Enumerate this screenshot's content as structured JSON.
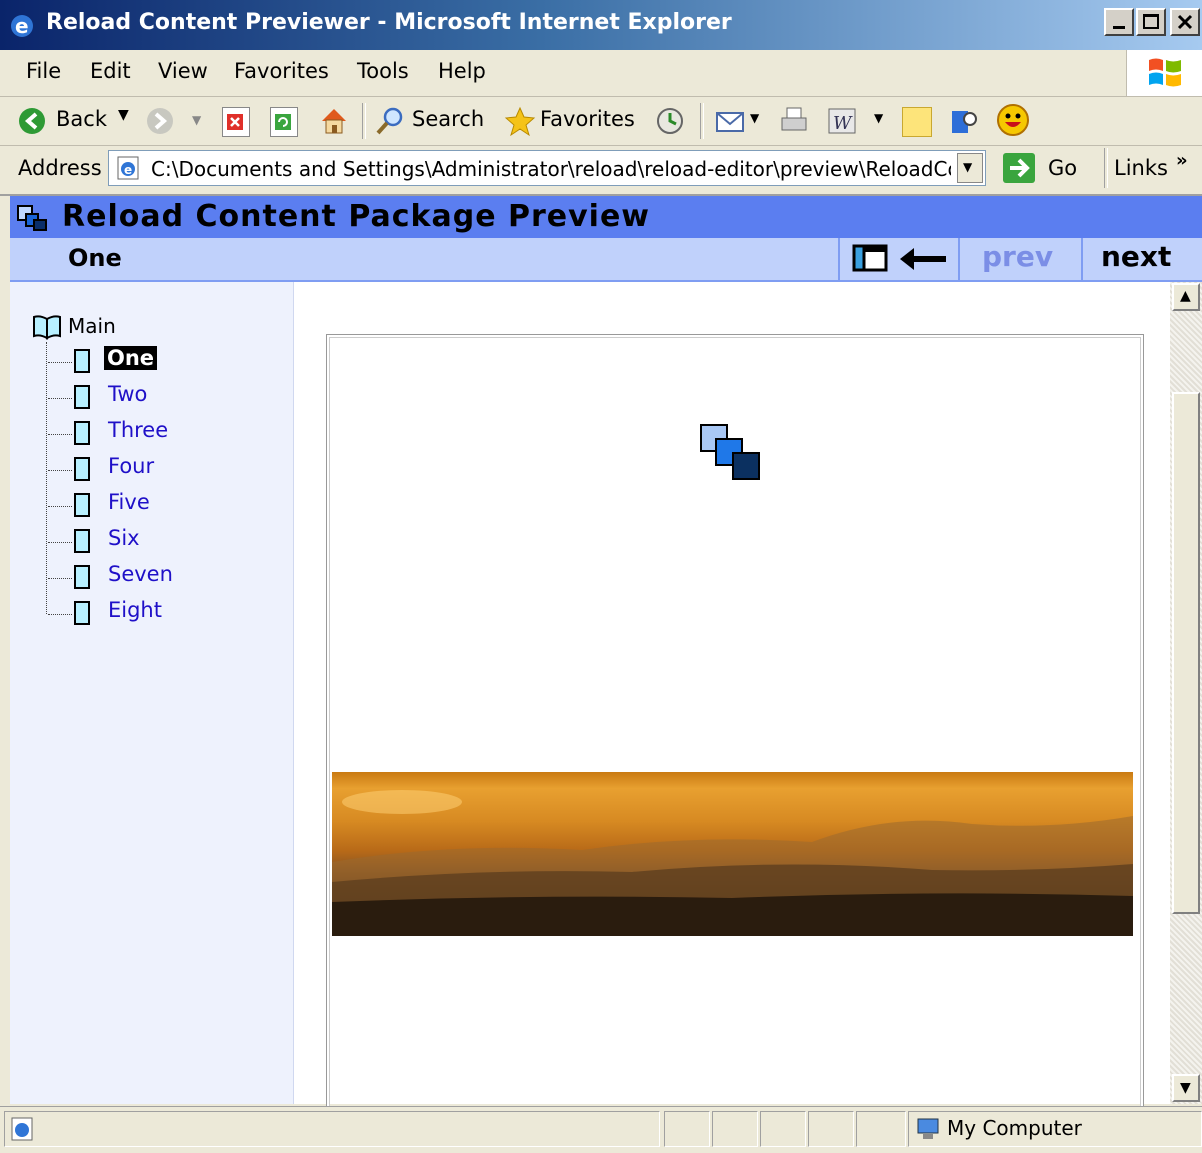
{
  "window": {
    "title": "Reload Content Previewer - Microsoft Internet Explorer"
  },
  "menu": [
    "File",
    "Edit",
    "View",
    "Favorites",
    "Tools",
    "Help"
  ],
  "toolbar": {
    "back_label": "Back",
    "search_label": "Search",
    "favorites_label": "Favorites"
  },
  "address": {
    "label": "Address",
    "value": "C:\\Documents and Settings\\Administrator\\reload\\reload-editor\\preview\\ReloadCont",
    "go_label": "Go",
    "links_label": "Links",
    "more_label": "»"
  },
  "preview": {
    "package_title": "Reload Content Package Preview",
    "current_item": "One",
    "prev_label": "prev",
    "next_label": "next"
  },
  "tree": {
    "root": "Main",
    "items": [
      "One",
      "Two",
      "Three",
      "Four",
      "Five",
      "Six",
      "Seven",
      "Eight"
    ],
    "selected_index": 0
  },
  "statusbar": {
    "zone": "My Computer"
  },
  "colors": {
    "header_blue": "#5b7ef0",
    "subheader_blue": "#c0d1fb",
    "tree_bg": "#eef2fd",
    "link_color": "#1f10c8"
  }
}
